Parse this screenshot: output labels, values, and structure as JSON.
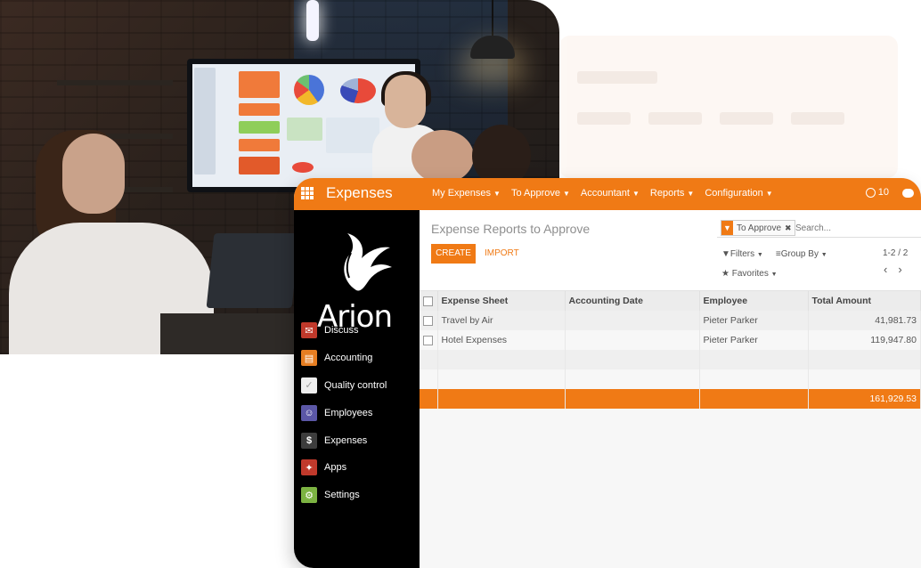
{
  "topbar": {
    "app_title": "Expenses",
    "menu": [
      {
        "label": "My Expenses"
      },
      {
        "label": "To Approve"
      },
      {
        "label": "Accountant"
      },
      {
        "label": "Reports"
      },
      {
        "label": "Configuration"
      }
    ],
    "notification_count": "10"
  },
  "sidebar": {
    "logo_text": "Arion",
    "items": [
      {
        "label": "Discuss",
        "icon": "chat-icon",
        "color": "#c0392b"
      },
      {
        "label": "Accounting",
        "icon": "accounting-icon",
        "color": "#e67e22"
      },
      {
        "label": "Quality control",
        "icon": "quality-icon",
        "color": "#eeeeee"
      },
      {
        "label": "Employees",
        "icon": "employees-icon",
        "color": "#5b57a6"
      },
      {
        "label": "Expenses",
        "icon": "dollar-icon",
        "color": "#3d3d3d"
      },
      {
        "label": "Apps",
        "icon": "apps-icon",
        "color": "#c0392b"
      },
      {
        "label": "Settings",
        "icon": "gear-icon",
        "color": "#7cb342"
      }
    ]
  },
  "control_panel": {
    "title": "Expense Reports to Approve",
    "create_label": "CREATE",
    "import_label": "IMPORT",
    "facet_label": "To Approve",
    "search_placeholder": "Search...",
    "filters_label": "Filters",
    "group_by_label": "Group By",
    "favorites_label": "Favorites",
    "pager": "1-2 / 2"
  },
  "table": {
    "columns": [
      "Expense Sheet",
      "Accounting Date",
      "Employee",
      "Total Amount"
    ],
    "rows": [
      {
        "sheet": "Travel by Air",
        "date": "",
        "employee": "Pieter Parker",
        "amount": "41,981.73"
      },
      {
        "sheet": "Hotel Expenses",
        "date": "",
        "employee": "Pieter Parker",
        "amount": "119,947.80"
      }
    ],
    "total": "161,929.53"
  },
  "colors": {
    "accent": "#f07a15",
    "sidebar_bg": "#000000"
  }
}
